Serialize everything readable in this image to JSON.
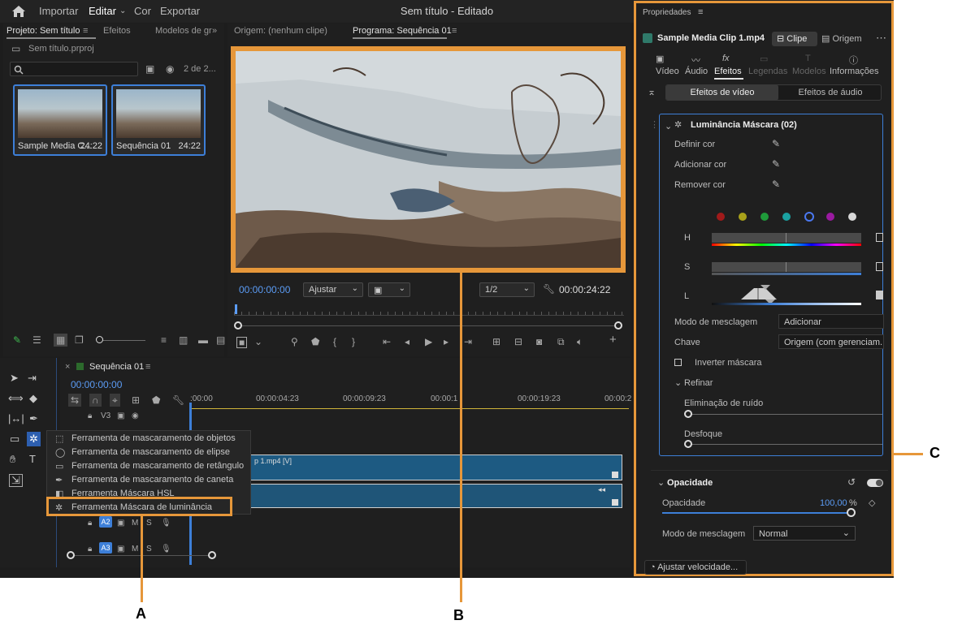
{
  "menu": {
    "importar": "Importar",
    "editar": "Editar",
    "cor": "Cor",
    "exportar": "Exportar",
    "title": "Sem título - Editado"
  },
  "project_panel": {
    "tab_project": "Projeto: Sem título",
    "tab_effects": "Efeitos",
    "tab_models": "Modelos de gr",
    "file_name": "Sem título.prproj",
    "count": "2 de 2...",
    "items": [
      {
        "name": "Sample Media C...",
        "duration": "24:22"
      },
      {
        "name": "Sequência 01",
        "duration": "24:22"
      }
    ]
  },
  "monitor": {
    "tab_source": "Origem: (nenhum clipe)",
    "tab_program": "Programa: Sequência 01",
    "timecode": "00:00:00:00",
    "fit": "Ajustar",
    "resolution": "1/2",
    "duration": "00:00:24:22"
  },
  "timeline": {
    "tab": "Sequência 01",
    "timecode": "00:00:00:00",
    "ruler": [
      ":00:00",
      "00:00:04:23",
      "00:00:09:23",
      "00:00:1",
      "00:00:19:23",
      "00:00:2"
    ],
    "v_track": "V3",
    "a2": "A2",
    "a3": "A3",
    "clip_label": "p 1.mp4 [V]"
  },
  "tool_menu": {
    "items": [
      "Ferramenta de mascaramento de objetos",
      "Ferramenta de mascaramento de elipse",
      "Ferramenta de mascaramento de retângulo",
      "Ferramenta de mascaramento de caneta",
      "Ferramenta Máscara HSL",
      "Ferramenta Máscara de luminância"
    ]
  },
  "properties": {
    "title": "Propriedades",
    "clip_name": "Sample Media Clip 1.mp4",
    "btn_clip": "Clipe",
    "btn_origin": "Origem",
    "tabs": [
      "Vídeo",
      "Áudio",
      "Efeitos",
      "Legendas",
      "Modelos",
      "Informações"
    ],
    "seg_video": "Efeitos de vídeo",
    "seg_audio": "Efeitos de áudio",
    "effect_name": "Luminância Máscara (02)",
    "define_color": "Definir cor",
    "add_color": "Adicionar cor",
    "remove_color": "Remover cor",
    "h": "H",
    "s": "S",
    "l": "L",
    "blend_mode_label": "Modo de mesclagem",
    "blend_mode_value": "Adicionar",
    "key_label": "Chave",
    "key_value": "Origem (com gerenciam...",
    "invert": "Inverter máscara",
    "refine": "Refinar",
    "noise": "Eliminação de ruído",
    "blur": "Desfoque",
    "opacity_section": "Opacidade",
    "opacity_label": "Opacidade",
    "opacity_value": "100,00",
    "opacity_unit": "%",
    "blend_label2": "Modo de mesclagem",
    "blend_value2": "Normal",
    "speed_btn": "Ajustar velocidade..."
  },
  "swatches": [
    "#a01a1a",
    "#a8a11a",
    "#1f9a3a",
    "#1aa0a0",
    "#2a54d8",
    "#9a1aa0",
    "#d8d8d8"
  ],
  "callouts": {
    "a": "A",
    "b": "B",
    "c": "C"
  }
}
